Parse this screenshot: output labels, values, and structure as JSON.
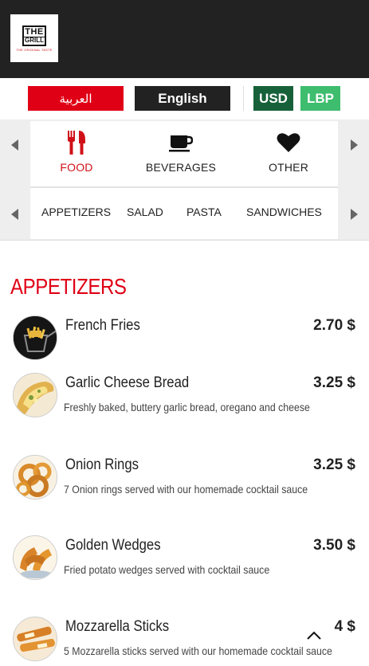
{
  "brand": {
    "logo_top": "THE",
    "logo_bottom": "GRILL",
    "logo_tagline": "THE ORIGINAL TASTE"
  },
  "languages": {
    "arabic_label": "العربية",
    "english_label": "English"
  },
  "currencies": {
    "usd_label": "USD",
    "lbp_label": "LBP"
  },
  "categories": [
    {
      "label": "FOOD",
      "icon": "fork-knife-icon",
      "active": true
    },
    {
      "label": "BEVERAGES",
      "icon": "coffee-cup-icon",
      "active": false
    },
    {
      "label": "OTHER",
      "icon": "heart-icon",
      "active": false
    }
  ],
  "subcategories": [
    "APPETIZERS",
    "SALAD",
    "PASTA",
    "SANDWICHES"
  ],
  "section": {
    "title": "APPETIZERS"
  },
  "items": [
    {
      "name": "French Fries",
      "price": "2.70 $",
      "description": ""
    },
    {
      "name": "Garlic Cheese Bread",
      "price": "3.25 $",
      "description": "Freshly baked, buttery garlic bread, oregano and cheese"
    },
    {
      "name": "Onion Rings",
      "price": "3.25 $",
      "description": "7 Onion rings served with our homemade cocktail sauce"
    },
    {
      "name": "Golden Wedges",
      "price": "3.50 $",
      "description": "Fried potato wedges served with cocktail sauce"
    },
    {
      "name": "Mozzarella Sticks",
      "price": "4 $",
      "description": "5 Mozzarella sticks served with our homemade cocktail sauce"
    }
  ],
  "colors": {
    "header_bg": "#222222",
    "accent_red": "#e00016",
    "usd_green": "#17613a",
    "lbp_green": "#3ebd6e"
  }
}
